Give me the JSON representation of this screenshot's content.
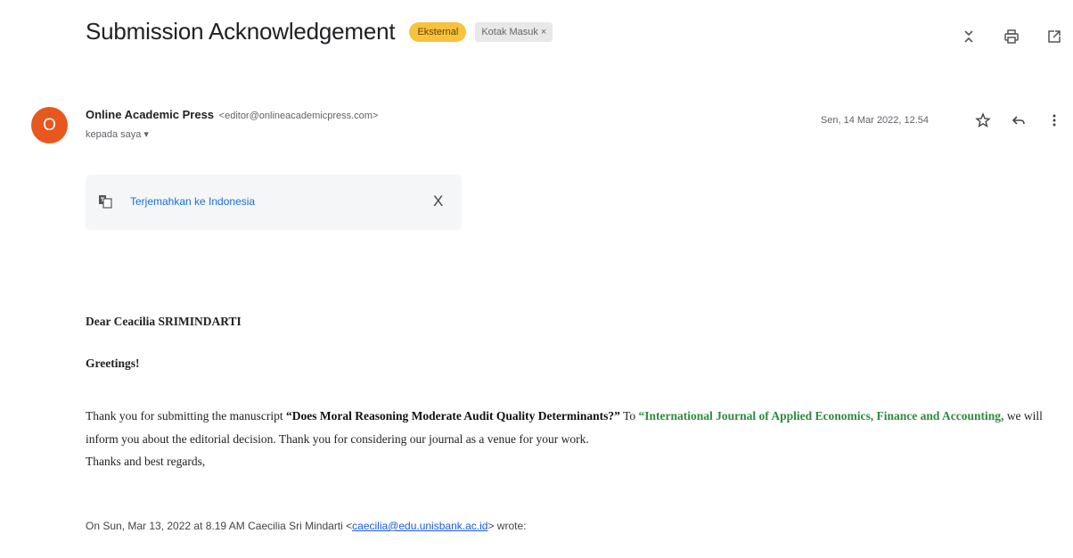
{
  "subject": "Submission Acknowledgement",
  "labels": {
    "external": "Eksternal",
    "inbox": "Kotak Masuk",
    "inbox_remove": "×"
  },
  "icons": {
    "toggle": "expand-collapse-icon",
    "print": "print-icon",
    "new_window": "open-new-window-icon",
    "star": "star-icon",
    "reply": "reply-icon",
    "more": "more-vert-icon",
    "translate": "translate-icon",
    "close": "close-icon"
  },
  "colors": {
    "avatar": "#e8571e",
    "external_label": "#f9c23c",
    "link": "#1a6ed8",
    "journal_green": "#2e8b3d"
  },
  "sender": {
    "avatar_letter": "O",
    "name": "Online Academic Press",
    "email": "<editor@onlineacademicpress.com>",
    "recipient": "kepada saya ▾"
  },
  "date": "Sen, 14 Mar 2022, 12.54",
  "translate": {
    "link": "Terjemahkan ke Indonesia",
    "close": "X"
  },
  "body": {
    "salutation": "Dear  Ceacilia SRIMINDARTI",
    "greetings": "Greetings!",
    "para_1": "Thank you for submitting the manuscript ",
    "manuscript_title": "“Does Moral Reasoning Moderate Audit Quality Determinants?”",
    "para_2": " To ",
    "journal": "“International Journal of Applied Economics, Finance and Accounting,",
    "para_3": " we will inform you about the editorial decision. Thank you for considering our journal as a venue for your work.",
    "closing": "Thanks and best regards,"
  },
  "quote": {
    "prefix": "On Sun, Mar 13, 2022 at 8.19 AM Caecilia Sri Mindarti <",
    "email": "caecilia@edu.unisbank.ac.id",
    "suffix": "> wrote:"
  }
}
